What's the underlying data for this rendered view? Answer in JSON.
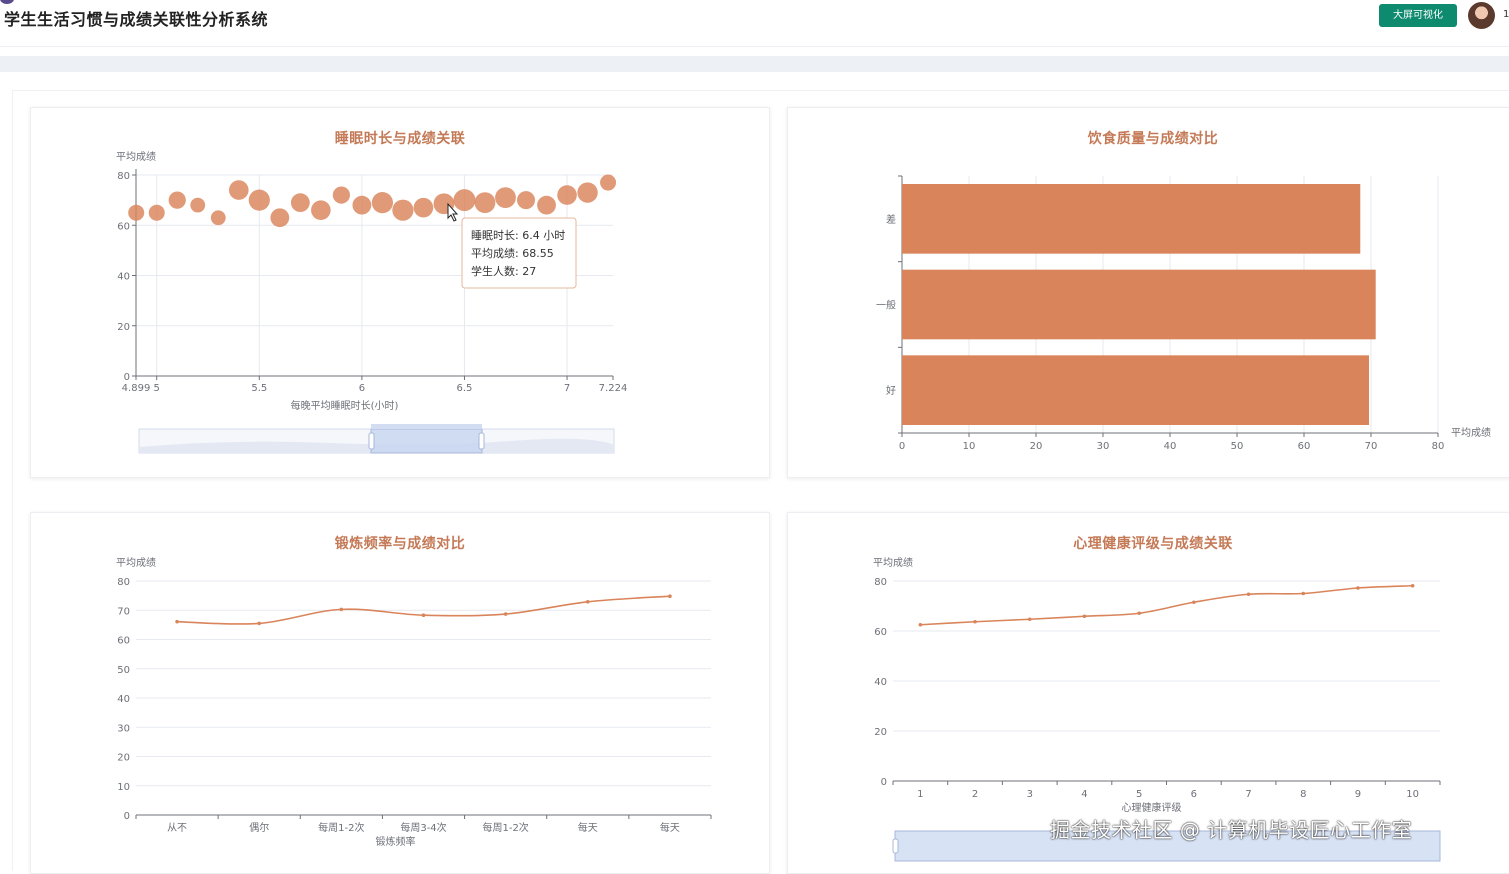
{
  "header": {
    "title": "学生生活习惯与成绩关联性分析系统",
    "screen_button": "大屏可视化",
    "user_fragment": "1"
  },
  "colors": {
    "accent": "#d9845a",
    "title": "#c57a57",
    "button": "#0e8a6e",
    "zoom": "#c6d5f0"
  },
  "watermark": "掘金技术社区 @ 计算机毕设匠心工作室",
  "chart_data": [
    {
      "type": "scatter",
      "title": "睡眠时长与成绩关联",
      "xlabel": "每晚平均睡眠时长(小时)",
      "ylabel": "平均成绩",
      "xlim": [
        4.899,
        7.224
      ],
      "ylim": [
        0,
        80
      ],
      "xticks": [
        "4.899",
        "5",
        "5.5",
        "6",
        "6.5",
        "7",
        "7.224"
      ],
      "yticks": [
        "0",
        "20",
        "40",
        "60",
        "80"
      ],
      "x_tick_values": [
        4.899,
        5,
        5.5,
        6,
        6.5,
        7,
        7.224
      ],
      "y_tick_values": [
        0,
        20,
        40,
        60,
        80
      ],
      "data_zoom": true,
      "points": [
        {
          "x": 4.9,
          "y": 65,
          "n": 15
        },
        {
          "x": 5.0,
          "y": 65,
          "n": 15
        },
        {
          "x": 5.1,
          "y": 70,
          "n": 18
        },
        {
          "x": 5.2,
          "y": 68,
          "n": 12
        },
        {
          "x": 5.3,
          "y": 63,
          "n": 12
        },
        {
          "x": 5.4,
          "y": 74,
          "n": 24
        },
        {
          "x": 5.5,
          "y": 70,
          "n": 28
        },
        {
          "x": 5.6,
          "y": 63,
          "n": 22
        },
        {
          "x": 5.7,
          "y": 69,
          "n": 22
        },
        {
          "x": 5.8,
          "y": 66,
          "n": 24
        },
        {
          "x": 5.9,
          "y": 72,
          "n": 18
        },
        {
          "x": 6.0,
          "y": 68,
          "n": 22
        },
        {
          "x": 6.1,
          "y": 69,
          "n": 28
        },
        {
          "x": 6.2,
          "y": 66,
          "n": 28
        },
        {
          "x": 6.3,
          "y": 67,
          "n": 24
        },
        {
          "x": 6.4,
          "y": 68.55,
          "n": 27
        },
        {
          "x": 6.5,
          "y": 70,
          "n": 30
        },
        {
          "x": 6.6,
          "y": 69,
          "n": 27
        },
        {
          "x": 6.7,
          "y": 71,
          "n": 27
        },
        {
          "x": 6.8,
          "y": 70,
          "n": 20
        },
        {
          "x": 6.9,
          "y": 68,
          "n": 22
        },
        {
          "x": 7.0,
          "y": 72,
          "n": 24
        },
        {
          "x": 7.1,
          "y": 73,
          "n": 26
        },
        {
          "x": 7.2,
          "y": 77,
          "n": 15
        }
      ],
      "tooltip": {
        "lines": [
          "睡眠时长: 6.4 小时",
          "平均成绩: 68.55",
          "学生人数: 27"
        ]
      }
    },
    {
      "type": "bar",
      "orientation": "horizontal",
      "title": "饮食质量与成绩对比",
      "categories": [
        "差",
        "一般",
        "好"
      ],
      "values": [
        68.4,
        70.7,
        69.7
      ],
      "xlabel": "平均成绩",
      "xlim": [
        0,
        80
      ],
      "xticks": [
        "0",
        "10",
        "20",
        "30",
        "40",
        "50",
        "60",
        "70",
        "80"
      ],
      "x_tick_values": [
        0,
        10,
        20,
        30,
        40,
        50,
        60,
        70,
        80
      ]
    },
    {
      "type": "line",
      "title": "锻炼频率与成绩对比",
      "xlabel": "锻炼频率",
      "ylabel": "平均成绩",
      "categories": [
        "从不",
        "偶尔",
        "每周1-2次",
        "每周3-4次",
        "每周1-2次",
        "每天",
        "每天"
      ],
      "values": [
        66.1,
        65.5,
        70.3,
        68.3,
        68.7,
        72.9,
        74.8
      ],
      "ylim": [
        0,
        80
      ],
      "yticks": [
        "0",
        "10",
        "20",
        "30",
        "40",
        "50",
        "60",
        "70",
        "80"
      ],
      "y_tick_values": [
        0,
        10,
        20,
        30,
        40,
        50,
        60,
        70,
        80
      ]
    },
    {
      "type": "line",
      "title": "心理健康评级与成绩关联",
      "xlabel": "心理健康评级",
      "ylabel": "平均成绩",
      "categories": [
        "1",
        "2",
        "3",
        "4",
        "5",
        "6",
        "7",
        "8",
        "9",
        "10"
      ],
      "values": [
        62.5,
        63.7,
        64.7,
        65.9,
        67.1,
        71.5,
        74.7,
        75.0,
        77.2,
        78.1
      ],
      "ylim": [
        0,
        80
      ],
      "yticks": [
        "0",
        "20",
        "40",
        "60",
        "80"
      ],
      "y_tick_values": [
        0,
        20,
        40,
        60,
        80
      ],
      "data_zoom": true
    }
  ]
}
